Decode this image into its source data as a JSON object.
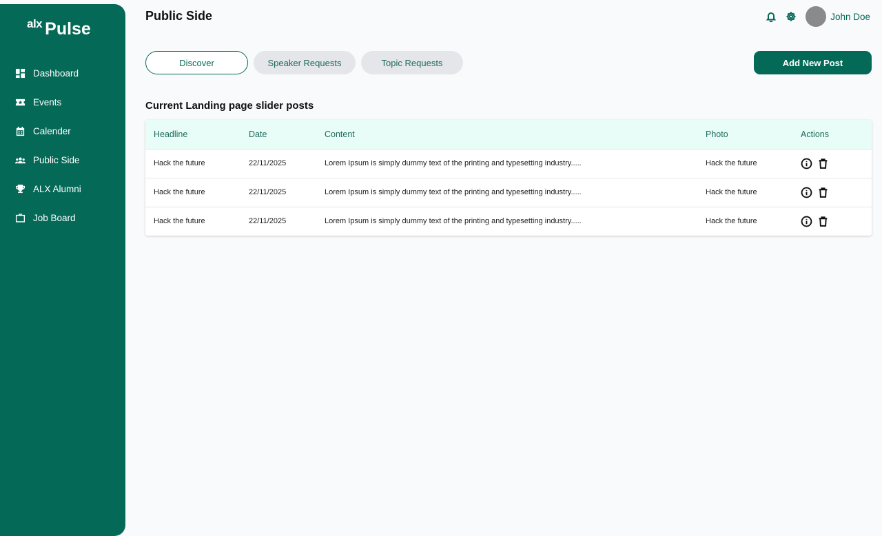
{
  "brand": {
    "alx": "alx",
    "pulse": "Pulse"
  },
  "sidebar": {
    "items": [
      {
        "label": "Dashboard",
        "icon": "dashboard-icon"
      },
      {
        "label": "Events",
        "icon": "ticket-icon"
      },
      {
        "label": "Calender",
        "icon": "calendar-icon"
      },
      {
        "label": "Public Side",
        "icon": "users-icon"
      },
      {
        "label": "ALX Alumni",
        "icon": "trophy-icon"
      },
      {
        "label": "Job Board",
        "icon": "briefcase-icon"
      }
    ]
  },
  "header": {
    "title": "Public Side",
    "user_name": "John Doe"
  },
  "tabs": [
    {
      "label": "Discover",
      "active": true
    },
    {
      "label": "Speaker Requests",
      "active": false
    },
    {
      "label": "Topic Requests",
      "active": false
    }
  ],
  "actions": {
    "add_post": "Add New Post"
  },
  "section": {
    "title": "Current Landing page slider posts"
  },
  "table": {
    "columns": [
      "Headline",
      "Date",
      "Content",
      "Photo",
      "Actions"
    ],
    "rows": [
      {
        "headline": "Hack the future",
        "date": "22/11/2025",
        "content": "Lorem Ipsum is simply dummy text of the printing and typesetting industry.....",
        "photo": "Hack the future"
      },
      {
        "headline": "Hack the future",
        "date": "22/11/2025",
        "content": "Lorem Ipsum is simply dummy text of the printing and typesetting industry.....",
        "photo": "Hack the future"
      },
      {
        "headline": "Hack the future",
        "date": "22/11/2025",
        "content": "Lorem Ipsum is simply dummy text of the printing and typesetting industry.....",
        "photo": "Hack the future"
      }
    ]
  },
  "colors": {
    "brand": "#046957",
    "header_row": "#e8fdf7",
    "tab_inactive": "#e4e6ea",
    "background": "#f9fafc"
  }
}
